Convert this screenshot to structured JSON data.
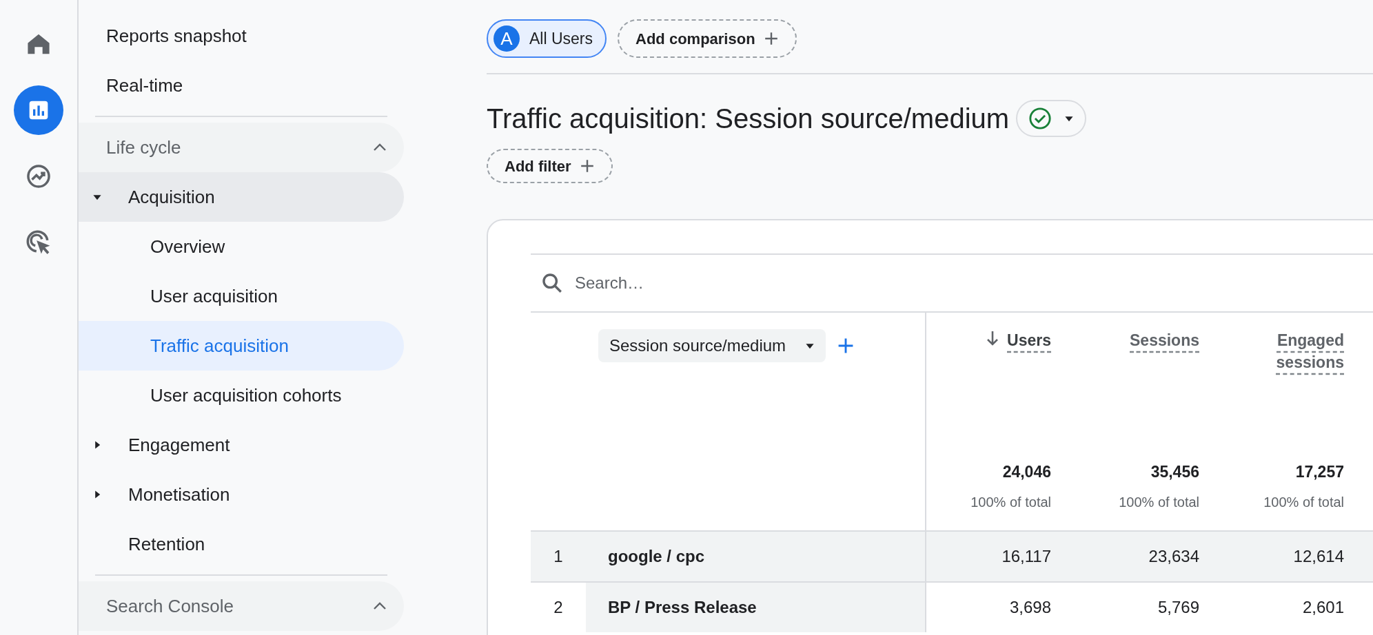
{
  "rail": [
    {
      "kind": "home",
      "selected": false
    },
    {
      "kind": "reports",
      "selected": true
    },
    {
      "kind": "explore",
      "selected": false
    },
    {
      "kind": "advertising",
      "selected": false
    }
  ],
  "sidebar": {
    "items": [
      {
        "kind": "item",
        "label": "Reports snapshot",
        "selected": false
      },
      {
        "kind": "item",
        "label": "Real-time",
        "selected": false
      },
      {
        "kind": "divider"
      },
      {
        "kind": "section",
        "label": "Life cycle",
        "expanded": true
      },
      {
        "kind": "group",
        "label": "Acquisition",
        "expanded": true,
        "children": [
          {
            "label": "Overview",
            "selected": false
          },
          {
            "label": "User acquisition",
            "selected": false
          },
          {
            "label": "Traffic acquisition",
            "selected": true
          },
          {
            "label": "User acquisition cohorts",
            "selected": false
          }
        ]
      },
      {
        "kind": "group",
        "label": "Engagement",
        "expanded": false
      },
      {
        "kind": "group",
        "label": "Monetisation",
        "expanded": false
      },
      {
        "kind": "leaf",
        "label": "Retention",
        "selected": false
      },
      {
        "kind": "divider"
      },
      {
        "kind": "section",
        "label": "Search Console",
        "expanded": true
      }
    ]
  },
  "segments": {
    "active": {
      "letter": "A",
      "label": "All Users"
    },
    "add": "Add comparison"
  },
  "title": "Traffic acquisition: Session source/medium",
  "add_filter": "Add filter",
  "table": {
    "search_placeholder": "Search…",
    "dimension": "Session source/medium",
    "columns": [
      {
        "label": "Users",
        "sorted": true,
        "total": "24,046",
        "share": "100% of total"
      },
      {
        "label": "Sessions",
        "sorted": false,
        "total": "35,456",
        "share": "100% of total"
      },
      {
        "label": "Engaged sessions",
        "sorted": false,
        "total": "17,257",
        "share": "100% of total"
      }
    ],
    "rows": [
      {
        "index": "1",
        "name": "google / cpc",
        "highlighted": true,
        "values": [
          "16,117",
          "23,634",
          "12,614"
        ]
      },
      {
        "index": "2",
        "name": "BP / Press Release",
        "highlighted": false,
        "values": [
          "3,698",
          "5,769",
          "2,601"
        ]
      }
    ]
  }
}
